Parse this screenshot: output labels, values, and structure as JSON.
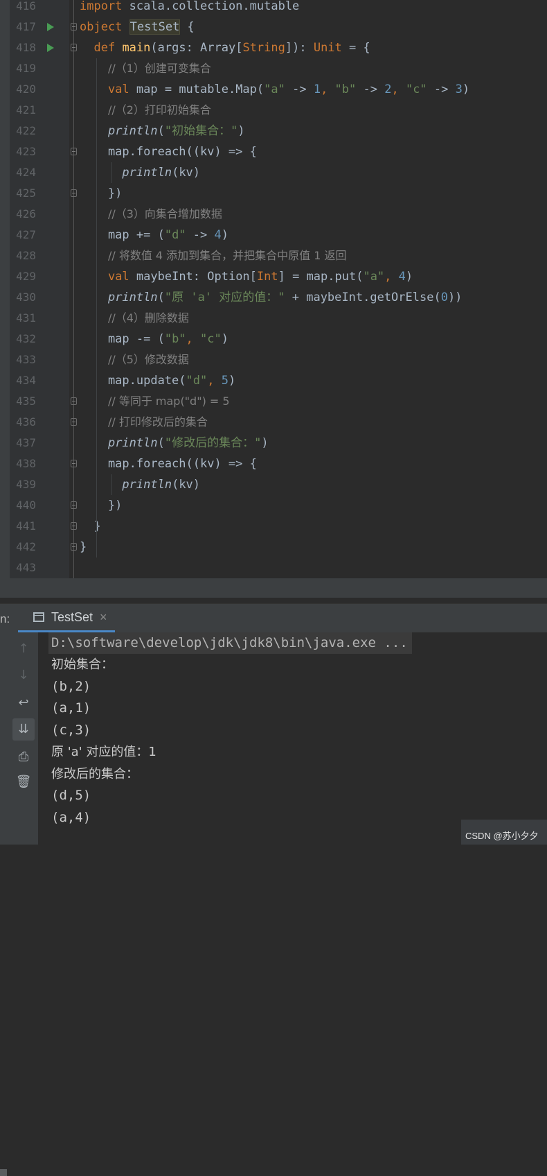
{
  "editor": {
    "lines": [
      {
        "no": "416",
        "parts": [
          [
            "kw",
            "import "
          ],
          [
            "",
            "scala.collection.mutable"
          ]
        ]
      },
      {
        "no": "417",
        "run": true,
        "fold": true,
        "parts": [
          [
            "kw",
            "object "
          ],
          [
            "objhl",
            "TestSet"
          ],
          [
            "",
            " {"
          ]
        ]
      },
      {
        "no": "418",
        "run": true,
        "fold": true,
        "parts": [
          [
            "",
            "  "
          ],
          [
            "kw",
            "def "
          ],
          [
            "fn",
            "main"
          ],
          [
            "",
            "(args: Array["
          ],
          [
            "kw",
            "String"
          ],
          [
            "",
            "]): "
          ],
          [
            "kw",
            "Unit"
          ],
          [
            "",
            " = {"
          ]
        ]
      },
      {
        "no": "419",
        "parts": [
          [
            "",
            "    "
          ],
          [
            "cm",
            "//（1）创建可变集合"
          ]
        ]
      },
      {
        "no": "420",
        "parts": [
          [
            "",
            "    "
          ],
          [
            "kw",
            "val "
          ],
          [
            "",
            "map = mutable.Map("
          ],
          [
            "str",
            "\"a\""
          ],
          [
            "",
            " -> "
          ],
          [
            "num",
            "1"
          ],
          [
            "kw",
            ", "
          ],
          [
            "str",
            "\"b\""
          ],
          [
            "",
            " -> "
          ],
          [
            "num",
            "2"
          ],
          [
            "kw",
            ", "
          ],
          [
            "str",
            "\"c\""
          ],
          [
            "",
            " -> "
          ],
          [
            "num",
            "3"
          ],
          [
            "",
            ")"
          ]
        ]
      },
      {
        "no": "421",
        "parts": [
          [
            "",
            "    "
          ],
          [
            "cm",
            "//（2）打印初始集合"
          ]
        ]
      },
      {
        "no": "422",
        "parts": [
          [
            "",
            "    "
          ],
          [
            "it",
            "println"
          ],
          [
            "",
            "("
          ],
          [
            "str",
            "\"初始集合：\""
          ],
          [
            "",
            ")"
          ]
        ]
      },
      {
        "no": "423",
        "fold": true,
        "parts": [
          [
            "",
            "    map.foreach((kv) => {"
          ]
        ]
      },
      {
        "no": "424",
        "parts": [
          [
            "",
            "      "
          ],
          [
            "it",
            "println"
          ],
          [
            "",
            "(kv)"
          ]
        ]
      },
      {
        "no": "425",
        "fold": true,
        "parts": [
          [
            "",
            "    })"
          ]
        ]
      },
      {
        "no": "426",
        "parts": [
          [
            "",
            "    "
          ],
          [
            "cm",
            "//（3）向集合增加数据"
          ]
        ]
      },
      {
        "no": "427",
        "parts": [
          [
            "",
            "    map += ("
          ],
          [
            "str",
            "\"d\""
          ],
          [
            "",
            " -> "
          ],
          [
            "num",
            "4"
          ],
          [
            "",
            ")"
          ]
        ]
      },
      {
        "no": "428",
        "parts": [
          [
            "",
            "    "
          ],
          [
            "cm",
            "// 将数值 4 添加到集合，并把集合中原值 1 返回"
          ]
        ]
      },
      {
        "no": "429",
        "parts": [
          [
            "",
            "    "
          ],
          [
            "kw",
            "val "
          ],
          [
            "",
            "maybeInt: Option["
          ],
          [
            "kw",
            "Int"
          ],
          [
            "",
            "] = map.put("
          ],
          [
            "str",
            "\"a\""
          ],
          [
            "kw",
            ", "
          ],
          [
            "num",
            "4"
          ],
          [
            "",
            ")"
          ]
        ]
      },
      {
        "no": "430",
        "parts": [
          [
            "",
            "    "
          ],
          [
            "it",
            "println"
          ],
          [
            "",
            "("
          ],
          [
            "str",
            "\"原 'a' 对应的值：\""
          ],
          [
            "",
            " + maybeInt.getOrElse("
          ],
          [
            "num",
            "0"
          ],
          [
            "",
            "))"
          ]
        ]
      },
      {
        "no": "431",
        "parts": [
          [
            "",
            "    "
          ],
          [
            "cm",
            "//（4）删除数据"
          ]
        ]
      },
      {
        "no": "432",
        "parts": [
          [
            "",
            "    map -= ("
          ],
          [
            "str",
            "\"b\""
          ],
          [
            "kw",
            ", "
          ],
          [
            "str",
            "\"c\""
          ],
          [
            "",
            ")"
          ]
        ]
      },
      {
        "no": "433",
        "parts": [
          [
            "",
            "    "
          ],
          [
            "cm",
            "//（5）修改数据"
          ]
        ]
      },
      {
        "no": "434",
        "parts": [
          [
            "",
            "    map.update("
          ],
          [
            "str",
            "\"d\""
          ],
          [
            "kw",
            ", "
          ],
          [
            "num",
            "5"
          ],
          [
            "",
            ")"
          ]
        ]
      },
      {
        "no": "435",
        "fold": true,
        "parts": [
          [
            "",
            "    "
          ],
          [
            "cm",
            "// 等同于 map(\"d\") = 5"
          ]
        ]
      },
      {
        "no": "436",
        "fold": true,
        "parts": [
          [
            "",
            "    "
          ],
          [
            "cm",
            "// 打印修改后的集合"
          ]
        ]
      },
      {
        "no": "437",
        "parts": [
          [
            "",
            "    "
          ],
          [
            "it",
            "println"
          ],
          [
            "",
            "("
          ],
          [
            "str",
            "\"修改后的集合：\""
          ],
          [
            "",
            ")"
          ]
        ]
      },
      {
        "no": "438",
        "fold": true,
        "parts": [
          [
            "",
            "    map.foreach((kv) => {"
          ]
        ]
      },
      {
        "no": "439",
        "parts": [
          [
            "",
            "      "
          ],
          [
            "it",
            "println"
          ],
          [
            "",
            "(kv)"
          ]
        ]
      },
      {
        "no": "440",
        "fold": true,
        "parts": [
          [
            "",
            "    })"
          ]
        ]
      },
      {
        "no": "441",
        "fold": true,
        "parts": [
          [
            "",
            "  }"
          ]
        ]
      },
      {
        "no": "442",
        "fold": true,
        "parts": [
          [
            "",
            "}"
          ]
        ]
      },
      {
        "no": "443",
        "parts": []
      }
    ]
  },
  "run_panel": {
    "prefix": "n:",
    "tab_label": "TestSet",
    "tab_close": "×",
    "command": "D:\\software\\develop\\jdk\\jdk8\\bin\\java.exe ...",
    "output": [
      "初始集合：",
      "(b,2)",
      "(a,1)",
      "(c,3)",
      "原 'a' 对应的值：1",
      "修改后的集合：",
      "(d,5)",
      "(a,4)"
    ],
    "toolbar": [
      {
        "name": "up-arrow-icon",
        "glyph": "↑",
        "dim": true
      },
      {
        "name": "down-arrow-icon",
        "glyph": "↓",
        "dim": true
      },
      {
        "name": "soft-wrap-icon",
        "glyph": "↩",
        "dim": false
      },
      {
        "name": "scroll-to-end-icon",
        "glyph": "⇊",
        "dim": false,
        "active": true
      },
      {
        "name": "print-icon",
        "glyph": "⎙",
        "dim": false
      },
      {
        "name": "trash-icon",
        "glyph": "🗑",
        "dim": false
      }
    ]
  },
  "watermark": "CSDN @苏小夕夕",
  "colors": {
    "keyword": "#cc7832",
    "string": "#6a8759",
    "number": "#6897bb",
    "comment": "#808080",
    "function": "#ffc66d",
    "text": "#a9b7c6",
    "run": "#499c54"
  }
}
